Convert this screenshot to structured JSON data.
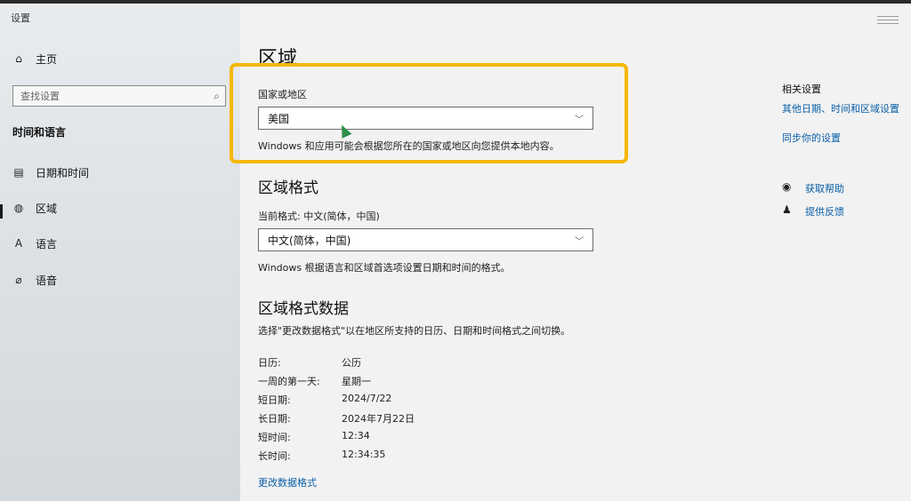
{
  "window": {
    "title": "设置"
  },
  "sidebar": {
    "home_label": "主页",
    "search_placeholder": "查找设置",
    "section_title": "时间和语言",
    "items": [
      {
        "label": "日期和时间",
        "icon": "calendar-clock-icon"
      },
      {
        "label": "区域",
        "icon": "globe-region-icon"
      },
      {
        "label": "语言",
        "icon": "language-icon"
      },
      {
        "label": "语音",
        "icon": "microphone-icon"
      }
    ]
  },
  "main": {
    "title": "区域",
    "country": {
      "label": "国家或地区",
      "value": "美国",
      "desc": "Windows 和应用可能会根据您所在的国家或地区向您提供本地内容。"
    },
    "format": {
      "heading": "区域格式",
      "current_label": "当前格式: 中文(简体，中国)",
      "value": "中文(简体，中国)",
      "desc": "Windows 根据语言和区域首选项设置日期和时间的格式。"
    },
    "format_data": {
      "heading": "区域格式数据",
      "desc": "选择\"更改数据格式\"以在地区所支持的日历、日期和时间格式之间切换。",
      "rows": [
        {
          "key": "日历:",
          "value": "公历"
        },
        {
          "key": "一周的第一天:",
          "value": "星期一"
        },
        {
          "key": "短日期:",
          "value": "2024/7/22"
        },
        {
          "key": "长日期:",
          "value": "2024年7月22日"
        },
        {
          "key": "短时间:",
          "value": "12:34"
        },
        {
          "key": "长时间:",
          "value": "12:34:35"
        }
      ],
      "change_link": "更改数据格式"
    }
  },
  "related": {
    "heading": "相关设置",
    "links": [
      "其他日期、时间和区域设置",
      "同步你的设置"
    ],
    "help": [
      {
        "label": "获取帮助",
        "icon": "help-chat-icon"
      },
      {
        "label": "提供反馈",
        "icon": "feedback-icon"
      }
    ]
  },
  "colors": {
    "highlight": "#f5b800",
    "link": "#0a5fa8",
    "cursor": "#2f8f4a"
  }
}
